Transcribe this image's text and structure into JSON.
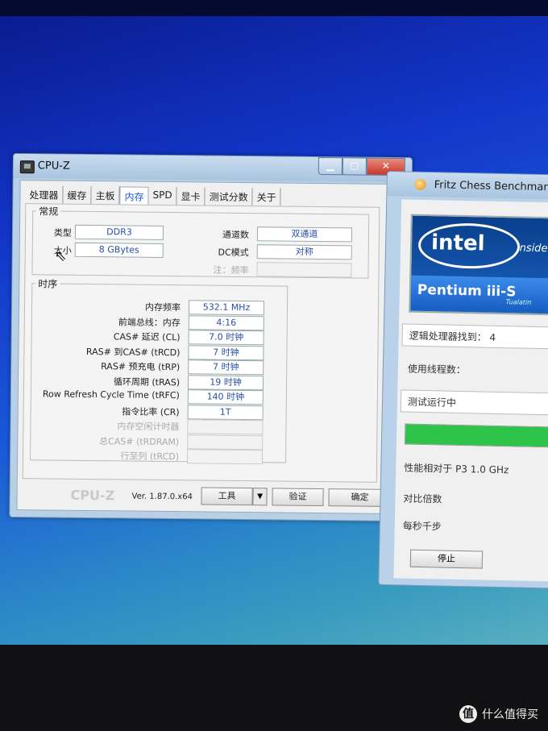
{
  "cpuz": {
    "title": "CPU-Z",
    "tabs": [
      "处理器",
      "缓存",
      "主板",
      "内存",
      "SPD",
      "显卡",
      "测试分数",
      "关于"
    ],
    "active_tab": 3,
    "general": {
      "legend": "常规",
      "type_label": "类型",
      "type_value": "DDR3",
      "size_label": "大小",
      "size_value": "8 GBytes",
      "channels_label": "通道数",
      "channels_value": "双通道",
      "dc_mode_label": "DC模式",
      "dc_mode_value": "对称",
      "nb_freq_label": "注：频率",
      "nb_freq_value": ""
    },
    "timings": {
      "legend": "时序",
      "rows": [
        {
          "label": "内存频率",
          "value": "532.1 MHz"
        },
        {
          "label": "前端总线：内存",
          "value": "4:16"
        },
        {
          "label": "CAS# 延迟 (CL)",
          "value": "7.0 时钟"
        },
        {
          "label": "RAS# 到CAS# (tRCD)",
          "value": "7 时钟"
        },
        {
          "label": "RAS# 预充电 (tRP)",
          "value": "7 时钟"
        },
        {
          "label": "循环周期 (tRAS)",
          "value": "19 时钟"
        },
        {
          "label": "Row Refresh Cycle Time (tRFC)",
          "value": "140 时钟"
        },
        {
          "label": "指令比率 (CR)",
          "value": "1T"
        },
        {
          "label": "内存空闲计时器",
          "value": ""
        },
        {
          "label": "总CAS# (tRDRAM)",
          "value": ""
        },
        {
          "label": "行至列 (tRCD)",
          "value": ""
        }
      ]
    },
    "footer": {
      "brand": "CPU-Z",
      "version": "Ver. 1.87.0.x64",
      "tools_label": "工具",
      "validate_label": "验证",
      "ok_label": "确定"
    }
  },
  "fritz": {
    "title": "Fritz Chess Benchmark",
    "logo": {
      "word": "intel",
      "inside": "inside",
      "product": "Pentium iii-S",
      "sub": "Tualatin"
    },
    "logical_processors": "逻辑处理器找到：  4",
    "threads_label": "使用线程数：",
    "running_label": "测试运行中",
    "progress": 1.0,
    "progress_color": "#2ec44a",
    "relative_label": "性能相对于 P3 1.0 GHz",
    "ratio_label": "对比倍数",
    "knps_label": "每秒千步",
    "stop_label": "停止"
  },
  "watermark": {
    "logo": "值",
    "text": "什么值得买"
  }
}
